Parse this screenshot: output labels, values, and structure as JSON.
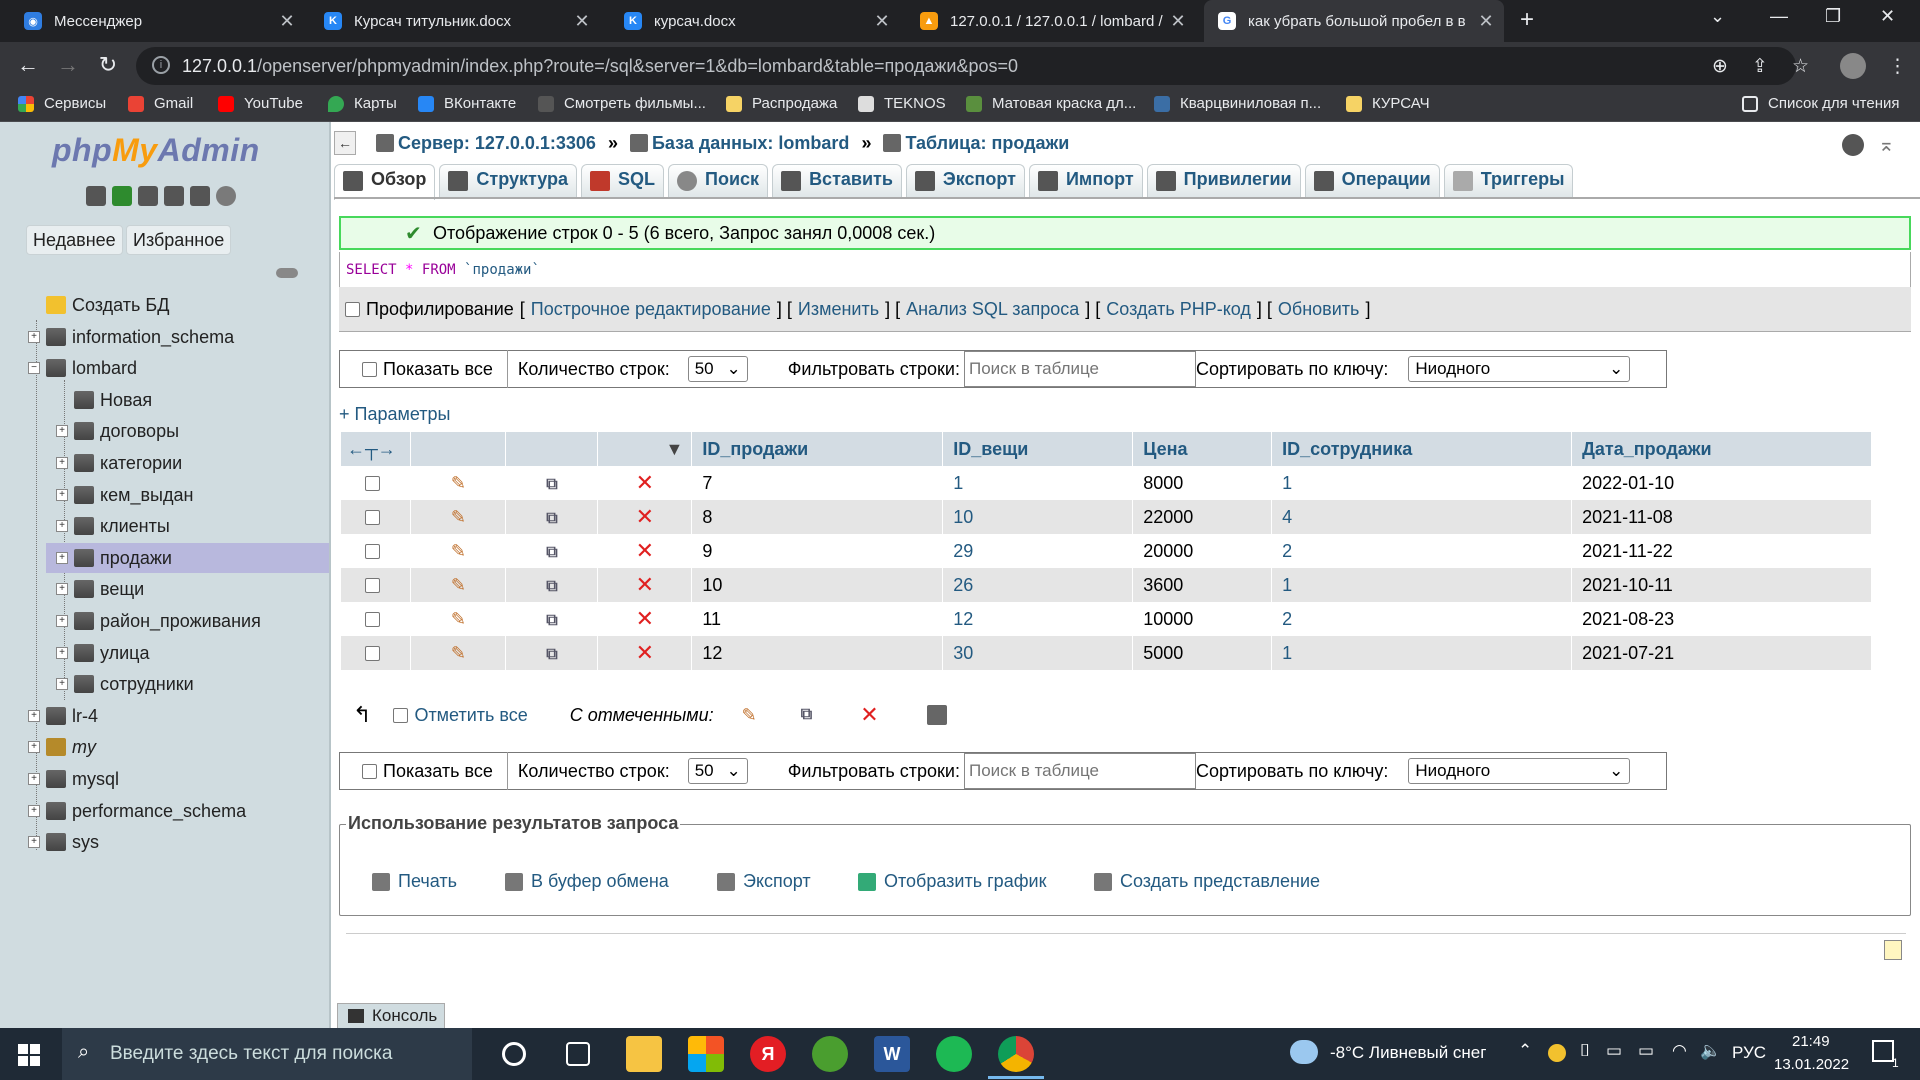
{
  "browser": {
    "tabs": [
      {
        "title": "Мессенджер",
        "favicon": "messenger-icon",
        "color": "#2f7de1"
      },
      {
        "title": "Курсач титульник.docx",
        "favicon": "vk-icon",
        "color": "#2787f5"
      },
      {
        "title": "курсач.docx",
        "favicon": "vk-icon",
        "color": "#2787f5"
      },
      {
        "title": "127.0.0.1 / 127.0.0.1 / lombard / .",
        "favicon": "phpmyadmin-icon",
        "color": "#f89c0e"
      },
      {
        "title": "как убрать большой пробел в в",
        "favicon": "google-icon",
        "color": "#ffffff"
      }
    ],
    "new_tab": "+",
    "url_host": "127.0.0.1",
    "url_path": "/openserver/phpmyadmin/index.php?route=/sql&server=1&db=lombard&table=продажи&pos=0",
    "bookmarks": [
      "Сервисы",
      "Gmail",
      "YouTube",
      "Карты",
      "ВКонтакте",
      "Смотреть фильмы...",
      "Распродажа",
      "TEKNOS",
      "Матовая краска дл...",
      "Кварцвиниловая п...",
      "КУРСАЧ"
    ],
    "reading_list": "Список для чтения"
  },
  "sidebar": {
    "logo_php": "php",
    "logo_my": "My",
    "logo_admin": "Admin",
    "tab_recent": "Недавнее",
    "tab_favorites": "Избранное",
    "tree": [
      {
        "label": "Создать БД",
        "level": 0,
        "expander": ""
      },
      {
        "label": "information_schema",
        "level": 0,
        "expander": "+"
      },
      {
        "label": "lombard",
        "level": 0,
        "expander": "−"
      },
      {
        "label": "Новая",
        "level": 1,
        "expander": ""
      },
      {
        "label": "договоры",
        "level": 1,
        "expander": "+"
      },
      {
        "label": "категории",
        "level": 1,
        "expander": "+"
      },
      {
        "label": "кем_выдан",
        "level": 1,
        "expander": "+"
      },
      {
        "label": "клиенты",
        "level": 1,
        "expander": "+"
      },
      {
        "label": "продажи",
        "level": 1,
        "expander": "+",
        "selected": true
      },
      {
        "label": "вещи",
        "level": 1,
        "expander": "+"
      },
      {
        "label": "район_проживания",
        "level": 1,
        "expander": "+"
      },
      {
        "label": "улица",
        "level": 1,
        "expander": "+"
      },
      {
        "label": "сотрудники",
        "level": 1,
        "expander": "+"
      },
      {
        "label": "lr-4",
        "level": 0,
        "expander": "+"
      },
      {
        "label": "my",
        "level": 0,
        "expander": "+",
        "italic": true
      },
      {
        "label": "mysql",
        "level": 0,
        "expander": "+"
      },
      {
        "label": "performance_schema",
        "level": 0,
        "expander": "+"
      },
      {
        "label": "sys",
        "level": 0,
        "expander": "+"
      }
    ]
  },
  "breadcrumb": {
    "server": "Сервер: 127.0.0.1:3306",
    "sep": "»",
    "database": "База данных: lombard",
    "table": "Таблица: продажи"
  },
  "tabs": [
    "Обзор",
    "Структура",
    "SQL",
    "Поиск",
    "Вставить",
    "Экспорт",
    "Импорт",
    "Привилегии",
    "Операции",
    "Триггеры"
  ],
  "success_message": "Отображение строк 0 - 5 (6 всего, Запрос занял 0,0008 сек.)",
  "sql": {
    "select": "SELECT",
    "star": "*",
    "from": "FROM",
    "table": "`продажи`"
  },
  "profiling": {
    "label": "Профилирование",
    "links": [
      "Построчное редактирование",
      "Изменить",
      "Анализ SQL запроса",
      "Создать PHP-код",
      "Обновить"
    ]
  },
  "nav": {
    "show_all": "Показать все",
    "rows_label": "Количество строк:",
    "rows_value": "50",
    "filter_label": "Фильтровать строки:",
    "filter_placeholder": "Поиск в таблице",
    "sort_label": "Сортировать по ключу:",
    "sort_value": "Ниодного"
  },
  "params_link": "+ Параметры",
  "table": {
    "columns": [
      "ID_продажи",
      "ID_вещи",
      "Цена",
      "ID_сотрудника",
      "Дата_продажи"
    ],
    "rows": [
      [
        "7",
        "1",
        "8000",
        "1",
        "2022-01-10"
      ],
      [
        "8",
        "10",
        "22000",
        "4",
        "2021-11-08"
      ],
      [
        "9",
        "29",
        "20000",
        "2",
        "2021-11-22"
      ],
      [
        "10",
        "26",
        "3600",
        "1",
        "2021-10-11"
      ],
      [
        "11",
        "12",
        "10000",
        "2",
        "2021-08-23"
      ],
      [
        "12",
        "30",
        "5000",
        "1",
        "2021-07-21"
      ]
    ]
  },
  "bulk": {
    "check_all": "Отметить все",
    "with_selected": "С отмеченными:"
  },
  "query_results": {
    "legend": "Использование результатов запроса",
    "links": [
      "Печать",
      "В буфер обмена",
      "Экспорт",
      "Отобразить график",
      "Создать представление"
    ]
  },
  "console_label": "Консоль",
  "taskbar": {
    "search_placeholder": "Введите здесь текст для поиска",
    "weather": "-8°C  Ливневый снег",
    "lang": "РУС",
    "time": "21:49",
    "date": "13.01.2022",
    "notifications": "1"
  }
}
